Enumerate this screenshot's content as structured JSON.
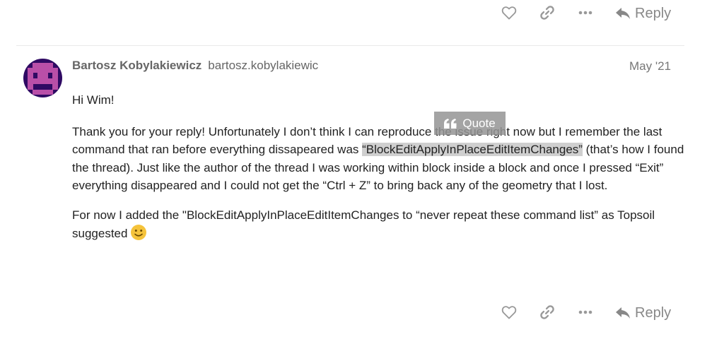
{
  "top_actions": {
    "like_icon": "heart-icon",
    "share_icon": "link-icon",
    "more_icon": "ellipsis-icon",
    "reply_label": "Reply"
  },
  "post": {
    "author_name": "Bartosz Kobylakiewicz",
    "author_username": "bartosz.kobylakiewic",
    "date": "May '21",
    "greeting": "Hi Wim!",
    "para1_before": "Thank you for your reply! Unfortunately I don’t think I can reproduce the issue right now but I remember the last command that ran before everything dissapeared was ",
    "para1_selected": "“BlockEditApplyInPlaceEditItemChanges”",
    "para1_after": " (that’s how I found the thread). Just like the author of the thread I was working within block inside a block and once I pressed “Exit” everything disappeared and I could not get the “Ctrl + Z” to bring back any of the geometry that I lost.",
    "para2": "For now I added the \"BlockEditApplyInPlaceEditItemChanges to “never repeat these command list” as Topsoil suggested",
    "emoji": "slightly-smiling-face"
  },
  "quote_button": {
    "icon": "quote-icon",
    "label": "Quote"
  },
  "bottom_actions": {
    "like_icon": "heart-icon",
    "share_icon": "link-icon",
    "more_icon": "ellipsis-icon",
    "reply_label": "Reply"
  },
  "colors": {
    "icon_gray": "#999999",
    "text": "#222222",
    "meta": "#666666",
    "selection": "#cfcfcf",
    "avatar_bg": "#2f0a63",
    "avatar_fg": "#b94fa8"
  }
}
